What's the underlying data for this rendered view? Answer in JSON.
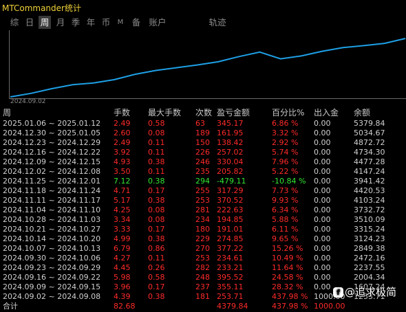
{
  "window": {
    "title": "MTCommander统计"
  },
  "tabs": [
    {
      "label": "综"
    },
    {
      "label": "日"
    },
    {
      "label": "周"
    },
    {
      "label": "月"
    },
    {
      "label": "季"
    },
    {
      "label": "年"
    },
    {
      "label": "币"
    },
    {
      "label": "M"
    },
    {
      "label": "备"
    },
    {
      "label": "账户"
    },
    {
      "label": "轨迹"
    }
  ],
  "active_tab": "周",
  "colors": {
    "accent_title": "#f0d23a",
    "profit": "#ff2a2a",
    "loss": "#33e633",
    "curve": "#1ea0e6"
  },
  "chart": {
    "start_label": "2024.09.02"
  },
  "chart_data": {
    "type": "line",
    "title": "",
    "xlabel": "",
    "ylabel": "",
    "x_start_label": "2024.09.02",
    "series": [
      {
        "values": [
          1253.71,
          1507.24,
          1836.82,
          2113.38,
          2237.55,
          2472.16,
          2849.38,
          3124.23,
          3315.24,
          3510.09,
          3732.72,
          4103.24,
          4420.53,
          3941.42,
          4147.24,
          4477.28,
          4734.3,
          4872.72,
          5034.67,
          5379.84
        ]
      }
    ]
  },
  "table": {
    "headers": {
      "period": "周",
      "trades": "手数",
      "max_lot": "最大手数",
      "count": "次数",
      "pnl": "盈亏金额",
      "pct": "百分比%",
      "flow": "出入金",
      "balance": "余额"
    },
    "rows": [
      {
        "period": "2025.01.06 ~ 2025.01.12",
        "trades": "2.49",
        "max_lot": "0.58",
        "count": "63",
        "pnl": "345.17",
        "pct": "6.86 %",
        "flow": "0.00",
        "balance": "5379.84",
        "loss": false
      },
      {
        "period": "2024.12.30 ~ 2025.01.05",
        "trades": "2.60",
        "max_lot": "0.08",
        "count": "189",
        "pnl": "161.95",
        "pct": "3.32 %",
        "flow": "0.00",
        "balance": "5034.67",
        "loss": false
      },
      {
        "period": "2024.12.23 ~ 2024.12.29",
        "trades": "2.49",
        "max_lot": "0.11",
        "count": "150",
        "pnl": "138.42",
        "pct": "2.92 %",
        "flow": "0.00",
        "balance": "4872.72",
        "loss": false
      },
      {
        "period": "2024.12.16 ~ 2024.12.22",
        "trades": "3.92",
        "max_lot": "0.11",
        "count": "226",
        "pnl": "257.02",
        "pct": "5.74 %",
        "flow": "0.00",
        "balance": "4734.30",
        "loss": false
      },
      {
        "period": "2024.12.09 ~ 2024.12.15",
        "trades": "4.93",
        "max_lot": "0.38",
        "count": "246",
        "pnl": "330.04",
        "pct": "7.96 %",
        "flow": "0.00",
        "balance": "4477.28",
        "loss": false
      },
      {
        "period": "2024.12.02 ~ 2024.12.08",
        "trades": "3.50",
        "max_lot": "0.11",
        "count": "235",
        "pnl": "205.82",
        "pct": "5.22 %",
        "flow": "0.00",
        "balance": "4147.24",
        "loss": false
      },
      {
        "period": "2024.11.25 ~ 2024.12.01",
        "trades": "7.12",
        "max_lot": "0.38",
        "count": "294",
        "pnl": "-479.11",
        "pct": "-10.84 %",
        "flow": "0.00",
        "balance": "3941.42",
        "loss": true
      },
      {
        "period": "2024.11.18 ~ 2024.11.24",
        "trades": "4.71",
        "max_lot": "0.17",
        "count": "255",
        "pnl": "317.29",
        "pct": "7.73 %",
        "flow": "0.00",
        "balance": "4420.53",
        "loss": false
      },
      {
        "period": "2024.11.11 ~ 2024.11.17",
        "trades": "5.17",
        "max_lot": "0.38",
        "count": "253",
        "pnl": "370.52",
        "pct": "9.93 %",
        "flow": "0.00",
        "balance": "4103.24",
        "loss": false
      },
      {
        "period": "2024.11.04 ~ 2024.11.10",
        "trades": "4.25",
        "max_lot": "0.08",
        "count": "281",
        "pnl": "222.63",
        "pct": "6.34 %",
        "flow": "0.00",
        "balance": "3732.72",
        "loss": false
      },
      {
        "period": "2024.10.28 ~ 2024.11.03",
        "trades": "3.34",
        "max_lot": "0.08",
        "count": "234",
        "pnl": "194.85",
        "pct": "5.88 %",
        "flow": "0.00",
        "balance": "3510.09",
        "loss": false
      },
      {
        "period": "2024.10.21 ~ 2024.10.27",
        "trades": "3.33",
        "max_lot": "0.17",
        "count": "180",
        "pnl": "191.01",
        "pct": "6.11 %",
        "flow": "0.00",
        "balance": "3315.24",
        "loss": false
      },
      {
        "period": "2024.10.14 ~ 2024.10.20",
        "trades": "4.99",
        "max_lot": "0.38",
        "count": "229",
        "pnl": "274.85",
        "pct": "9.65 %",
        "flow": "0.00",
        "balance": "3124.23",
        "loss": false
      },
      {
        "period": "2024.10.07 ~ 2024.10.13",
        "trades": "6.79",
        "max_lot": "0.86",
        "count": "270",
        "pnl": "377.22",
        "pct": "15.26 %",
        "flow": "0.00",
        "balance": "2849.38",
        "loss": false
      },
      {
        "period": "2024.09.30 ~ 2024.10.06",
        "trades": "4.27",
        "max_lot": "0.11",
        "count": "253",
        "pnl": "234.61",
        "pct": "10.49 %",
        "flow": "0.00",
        "balance": "2472.16",
        "loss": false
      },
      {
        "period": "2024.09.23 ~ 2024.09.29",
        "trades": "4.45",
        "max_lot": "0.26",
        "count": "282",
        "pnl": "233.21",
        "pct": "11.64 %",
        "flow": "0.00",
        "balance": "2237.55",
        "loss": false
      },
      {
        "period": "2024.09.16 ~ 2024.09.22",
        "trades": "5.98",
        "max_lot": "0.58",
        "count": "248",
        "pnl": "395.52",
        "pct": "24.58 %",
        "flow": "0.00",
        "balance": "2004.34",
        "loss": false
      },
      {
        "period": "2024.09.09 ~ 2024.09.15",
        "trades": "3.96",
        "max_lot": "0.17",
        "count": "237",
        "pnl": "355.11",
        "pct": "28.32 %",
        "flow": "0.00",
        "balance": "1607.24",
        "loss": false
      },
      {
        "period": "2024.09.02 ~ 2024.09.08",
        "trades": "4.39",
        "max_lot": "0.38",
        "count": "181",
        "pnl": "253.71",
        "pct": "437.98 %",
        "flow": "1000.00",
        "balance": "1253.71",
        "loss": false
      }
    ],
    "total": {
      "period": "合计",
      "trades": "82.68",
      "max_lot": "",
      "count": "",
      "pnl": "4379.84",
      "pct": "437.98 %",
      "flow": "1000.00",
      "balance": ""
    }
  },
  "watermark": {
    "text": "@追求极简"
  }
}
